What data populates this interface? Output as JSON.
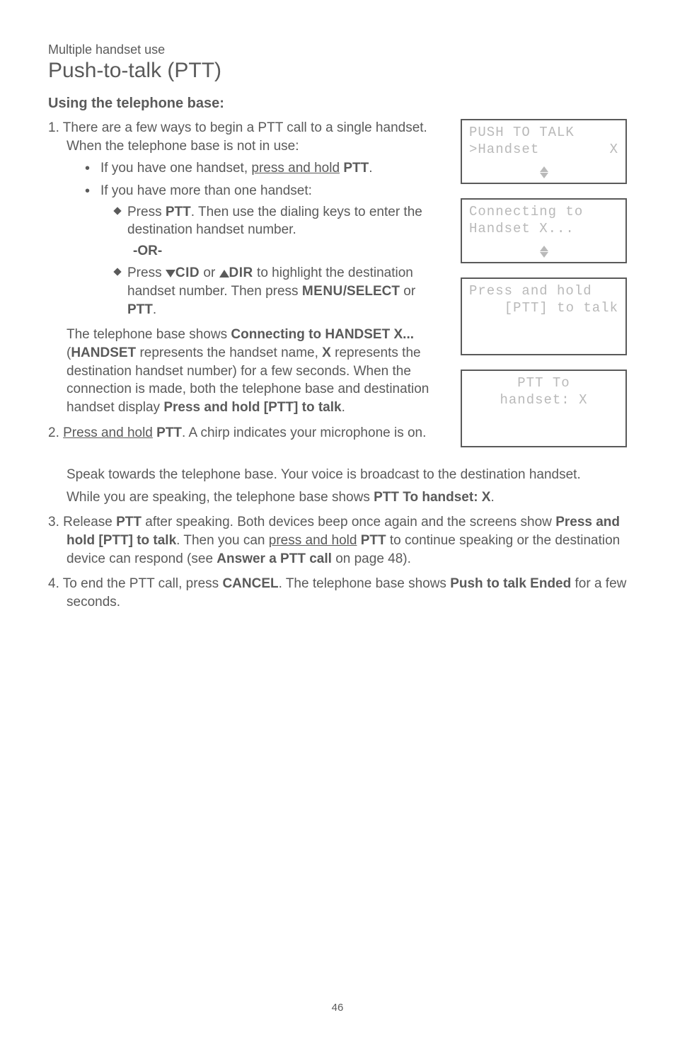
{
  "overline": "Multiple handset use",
  "title": "Push-to-talk (PTT)",
  "subheading": "Using the telephone base:",
  "list": {
    "item1_num": "1. ",
    "item1_a": "There are a few ways to begin a PTT call to a single handset. When the telephone base is not in use:",
    "b1_a": "If you have one handset, ",
    "b1_b_u": "press and hold",
    "b1_c": " ",
    "b1_d_b": "PTT",
    "b1_e": ".",
    "b2": "If you have more than one handset:",
    "d1_a": "Press ",
    "d1_b_b": "PTT",
    "d1_c": ". Then use the dialing keys to enter the destination handset number.",
    "or": "-OR-",
    "d2_a": "Press ",
    "d2_cid": "CID",
    "d2_or": " or ",
    "d2_dir": "DIR",
    "d2_b": " to highlight the destination handset number. Then press ",
    "d2_menu": "MENU",
    "d2_sel": "/SELECT",
    "d2_or2": " or ",
    "d2_ptt": "PTT",
    "d2_end": ".",
    "para1_a": "The telephone base shows ",
    "para1_b_b": "Connecting to HANDSET X...",
    "para1_c": " (",
    "para1_d_b": "HANDSET",
    "para1_e": " represents the handset name, ",
    "para1_f_b": "X",
    "para1_g": " represents the destination handset number) for a few seconds. When the connection is made, both the telephone base and destination handset display ",
    "para1_h_b": "Press and hold [PTT] to talk",
    "para1_i": ".",
    "item2_num": "2. ",
    "item2_a_u": "Press and hold",
    "item2_b": " ",
    "item2_c_b": "PTT",
    "item2_d": ". A chirp indicates your microphone is on.",
    "item2_p1": "Speak towards the telephone base. Your voice is broadcast to the destination handset.",
    "item2_p2_a": "While you are speaking, the telephone base shows ",
    "item2_p2_b_b": "PTT To handset: X",
    "item2_p2_c": ".",
    "item3_num": "3. ",
    "item3_a": "Release ",
    "item3_b_b": "PTT",
    "item3_c": " after speaking. Both devices beep once again and the screens show ",
    "item3_d_b": "Press and hold [PTT] to talk",
    "item3_e": ". Then you can ",
    "item3_f_u": "press and hold",
    "item3_g": " ",
    "item3_h_b": "PTT",
    "item3_i": " to continue speaking or the destination device can respond (see ",
    "item3_j_b": "Answer a PTT call",
    "item3_k": " on page 48).",
    "item4_num": "4. ",
    "item4_a": "To end the PTT call, press ",
    "item4_b_b": "CANCEL",
    "item4_c": ". The telephone base shows ",
    "item4_d_b": "Push to talk Ended",
    "item4_e": " for a few seconds."
  },
  "lcd1": {
    "row1": "PUSH TO TALK",
    "row2a": ">Handset",
    "row2b": "X"
  },
  "lcd2": {
    "row1": "Connecting to",
    "row2": "Handset X..."
  },
  "lcd3": {
    "row1": "Press and hold",
    "row2": "[PTT] to talk"
  },
  "lcd4": {
    "row1": "PTT To",
    "row2": "handset: X"
  },
  "pageNum": "46"
}
